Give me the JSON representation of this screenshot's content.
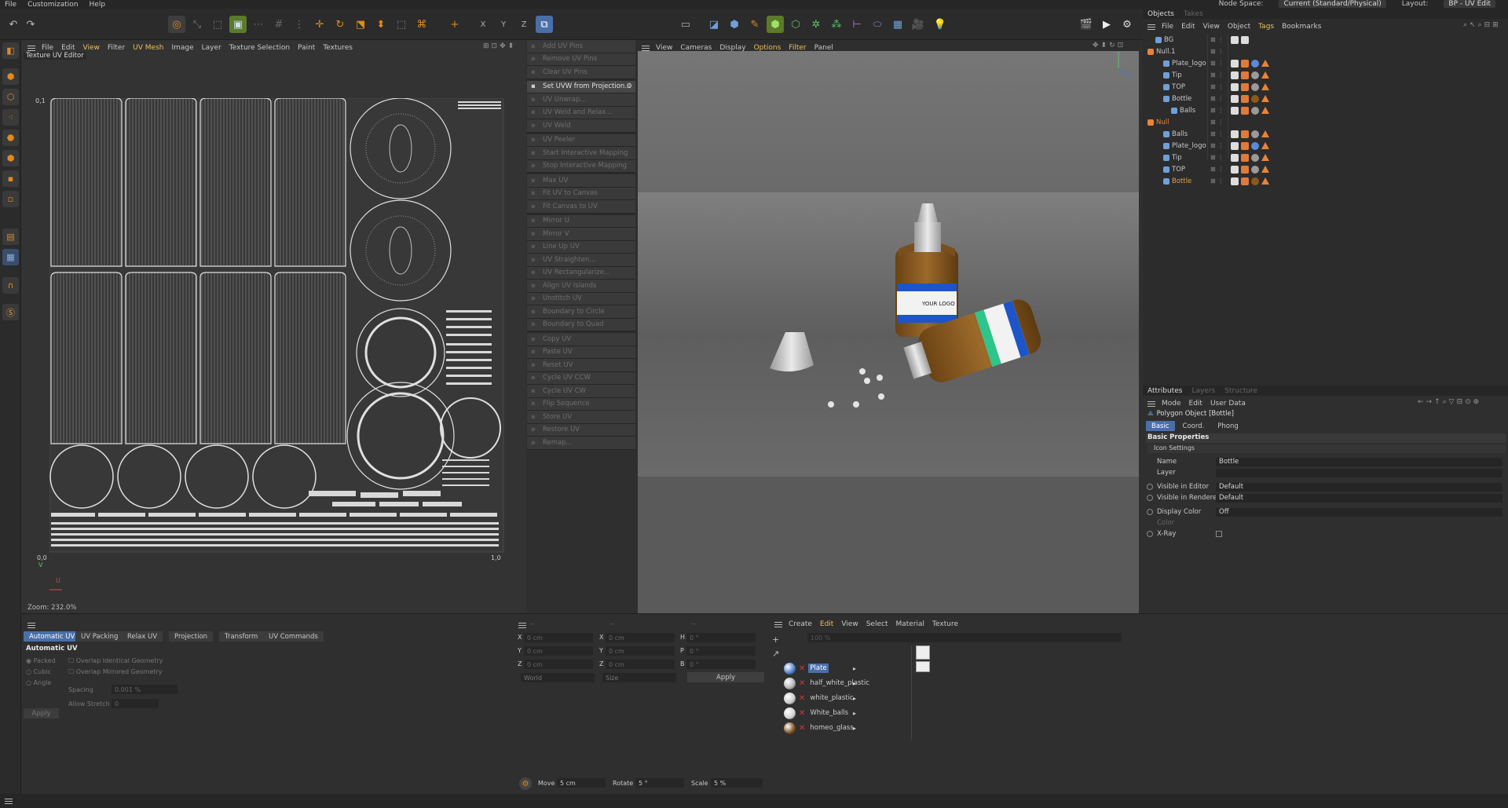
{
  "menubar": {
    "items": [
      "File",
      "Customization",
      "Help"
    ],
    "node_space_label": "Node Space:",
    "node_space_value": "Current (Standard/Physical)",
    "layout_label": "Layout:",
    "layout_value": "BP - UV Edit"
  },
  "uv_editor": {
    "menu": [
      "File",
      "Edit",
      "View",
      "Filter",
      "UV Mesh",
      "Image",
      "Layer",
      "Texture Selection",
      "Paint",
      "Textures"
    ],
    "title": "Texture UV Editor",
    "corner_tl": "0,1",
    "corner_bl": "0,0",
    "corner_br": "1,0",
    "axis_v": "V",
    "axis_u": "U",
    "zoom": "Zoom: 232.0%"
  },
  "uv_commands": [
    {
      "label": "Add UV Pins",
      "active": false
    },
    {
      "label": "Remove UV Pins",
      "active": false
    },
    {
      "label": "Clear UV Pins",
      "active": false
    },
    {
      "label": "Set UVW from Projection...",
      "active": true,
      "gap": true
    },
    {
      "label": "UV Unwrap...",
      "active": false
    },
    {
      "label": "UV Weld and Relax...",
      "active": false
    },
    {
      "label": "UV Weld",
      "active": false
    },
    {
      "label": "UV Peeler",
      "active": false,
      "gap": true
    },
    {
      "label": "Start Interactive Mapping",
      "active": false
    },
    {
      "label": "Stop Interactive Mapping",
      "active": false
    },
    {
      "label": "Max UV",
      "active": false,
      "gap": true
    },
    {
      "label": "Fit UV to Canvas",
      "active": false
    },
    {
      "label": "Fit Canvas to UV",
      "active": false
    },
    {
      "label": "Mirror U",
      "active": false,
      "gap": true
    },
    {
      "label": "Mirror V",
      "active": false
    },
    {
      "label": "Line Up UV",
      "active": false
    },
    {
      "label": "UV Straighten...",
      "active": false
    },
    {
      "label": "UV Rectangularize...",
      "active": false
    },
    {
      "label": "Align UV Islands",
      "active": false
    },
    {
      "label": "Unstitch UV",
      "active": false
    },
    {
      "label": "Boundary to Circle",
      "active": false
    },
    {
      "label": "Boundary to Quad",
      "active": false
    },
    {
      "label": "Copy UV",
      "active": false,
      "gap": true
    },
    {
      "label": "Paste UV",
      "active": false
    },
    {
      "label": "Reset UV",
      "active": false
    },
    {
      "label": "Cycle UV CCW",
      "active": false
    },
    {
      "label": "Cycle UV CW",
      "active": false
    },
    {
      "label": "Flip Sequence",
      "active": false
    },
    {
      "label": "Store UV",
      "active": false
    },
    {
      "label": "Restore UV",
      "active": false
    },
    {
      "label": "Remap...",
      "active": false
    }
  ],
  "viewport": {
    "menu": [
      "View",
      "Cameras",
      "Display",
      "Options",
      "Filter",
      "Panel"
    ],
    "logo_text": "YOUR LOGO",
    "axis_y": "Y",
    "axis_z": "Z"
  },
  "objects": {
    "tabs": [
      "Objects",
      "Takes"
    ],
    "menu": [
      "File",
      "Edit",
      "View",
      "Object",
      "Tags",
      "Bookmarks"
    ],
    "tree": [
      {
        "name": "BG",
        "indent": 1,
        "tags": [
          "checker",
          "checker"
        ],
        "color": "#c8c8c8"
      },
      {
        "name": "Null.1",
        "indent": 0,
        "tags": [],
        "color": "#c8c8c8"
      },
      {
        "name": "Plate_logo",
        "indent": 2,
        "tags": [
          "checker",
          "phong",
          "blueball",
          "tri"
        ],
        "color": "#c8c8c8"
      },
      {
        "name": "Tip",
        "indent": 2,
        "tags": [
          "checker",
          "phong",
          "greyball",
          "tri"
        ],
        "color": "#c8c8c8"
      },
      {
        "name": "TOP",
        "indent": 2,
        "tags": [
          "checker",
          "phong",
          "greyball",
          "tri"
        ],
        "color": "#c8c8c8"
      },
      {
        "name": "Bottle",
        "indent": 2,
        "tags": [
          "checker",
          "phong",
          "brownball",
          "tri"
        ],
        "color": "#c8c8c8"
      },
      {
        "name": "Balls",
        "indent": 3,
        "tags": [
          "checker",
          "phong",
          "greyball",
          "tri"
        ],
        "color": "#c8c8c8"
      },
      {
        "name": "Null",
        "indent": 0,
        "tags": [],
        "color": "#e8833a"
      },
      {
        "name": "Balls",
        "indent": 2,
        "tags": [
          "checker",
          "phong",
          "greyball",
          "tri"
        ],
        "color": "#c8c8c8"
      },
      {
        "name": "Plate_logo",
        "indent": 2,
        "tags": [
          "checker",
          "phong",
          "blueball",
          "tri"
        ],
        "color": "#c8c8c8"
      },
      {
        "name": "Tip",
        "indent": 2,
        "tags": [
          "checker",
          "phong",
          "greyball",
          "tri"
        ],
        "color": "#c8c8c8"
      },
      {
        "name": "TOP",
        "indent": 2,
        "tags": [
          "checker",
          "phong",
          "greyball",
          "tri"
        ],
        "color": "#c8c8c8"
      },
      {
        "name": "Bottle",
        "indent": 2,
        "tags": [
          "checker",
          "phong",
          "brownball",
          "tri"
        ],
        "color": "#e8a040"
      }
    ]
  },
  "attributes": {
    "tabs": [
      "Attributes",
      "Layers",
      "Structure"
    ],
    "menu": [
      "Mode",
      "Edit",
      "User Data"
    ],
    "object_title": "Polygon Object [Bottle]",
    "subtabs": [
      "Basic",
      "Coord.",
      "Phong"
    ],
    "section": "Basic Properties",
    "icon_settings": "Icon Settings",
    "rows": [
      {
        "label": "Name",
        "value": "Bottle",
        "radio": false
      },
      {
        "label": "Layer",
        "value": "",
        "radio": false
      },
      {
        "label": "Visible in Editor",
        "value": "Default",
        "radio": true
      },
      {
        "label": "Visible in Renderer",
        "value": "Default",
        "radio": true
      },
      {
        "label": "Display Color",
        "value": "Off",
        "radio": true
      },
      {
        "label": "Color",
        "value": "",
        "radio": false
      },
      {
        "label": "X-Ray",
        "value": "",
        "radio": true
      }
    ]
  },
  "uv_tools": {
    "tabs": [
      "Automatic UV",
      "UV Packing",
      "Relax UV",
      "Projection",
      "Transform",
      "UV Commands"
    ],
    "title": "Automatic UV",
    "algorithms": [
      "Packed",
      "Cubic",
      "Angle"
    ],
    "options": [
      "Overlap Identical Geometry",
      "Overlap Mirrored Geometry"
    ],
    "spacing_label": "Spacing",
    "spacing_value": "0.001 %",
    "stretch_label": "Allow Stretch",
    "stretch_value": "0",
    "apply": "Apply"
  },
  "coords": {
    "headers": [
      "--",
      "--",
      "--"
    ],
    "rows": [
      {
        "a": "X",
        "av": "0 cm",
        "b": "X",
        "bv": "0 cm",
        "c": "H",
        "cv": "0 °"
      },
      {
        "a": "Y",
        "av": "0 cm",
        "b": "Y",
        "bv": "0 cm",
        "c": "P",
        "cv": "0 °"
      },
      {
        "a": "Z",
        "av": "0 cm",
        "b": "Z",
        "bv": "0 cm",
        "c": "B",
        "cv": "0 °"
      }
    ],
    "mode1": "World",
    "mode2": "Size",
    "apply": "Apply",
    "move_label": "Move",
    "move_value": "5 cm",
    "rotate_label": "Rotate",
    "rotate_value": "5 °",
    "scale_label": "Scale",
    "scale_value": "5 %"
  },
  "materials": {
    "menu": [
      "Create",
      "Edit",
      "View",
      "Select",
      "Material",
      "Texture"
    ],
    "zoom": "100 %",
    "items": [
      {
        "name": "Plate",
        "selected": true,
        "ball": "#4a7ac8"
      },
      {
        "name": "half_white_plastic",
        "selected": false,
        "ball": "#b0b0b0"
      },
      {
        "name": "white_plastic",
        "selected": false,
        "ball": "#c8c8c8"
      },
      {
        "name": "White_balls",
        "selected": false,
        "ball": "#d0d0d0"
      },
      {
        "name": "homeo_glass",
        "selected": false,
        "ball": "#7a4f1d"
      }
    ]
  }
}
